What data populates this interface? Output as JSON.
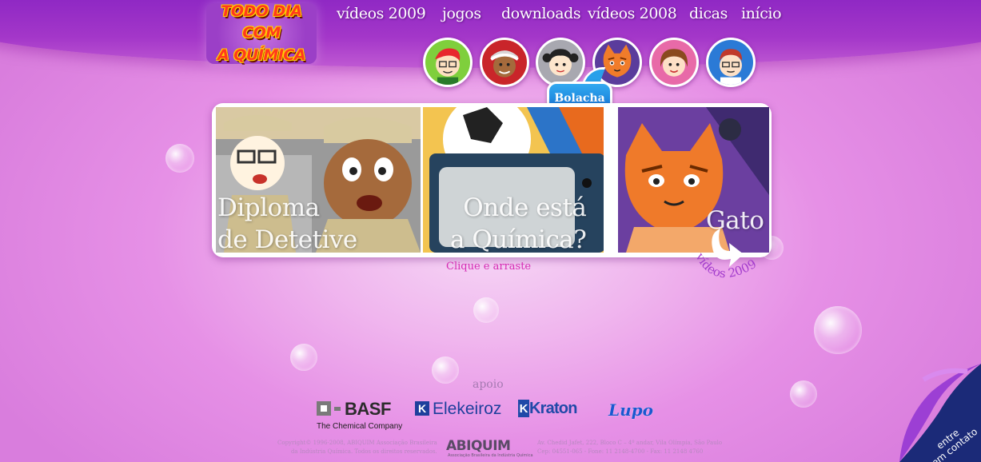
{
  "logo": {
    "line1": "TODO DIA COM",
    "line2": "A QUÍMICA"
  },
  "nav": [
    {
      "label": "vídeos 2009"
    },
    {
      "label": "jogos"
    },
    {
      "label": "downloads"
    },
    {
      "label": "vídeos 2008"
    },
    {
      "label": "dicas"
    },
    {
      "label": "início"
    }
  ],
  "characters": {
    "tooltip": "Bolacha"
  },
  "carousel": {
    "slides": [
      {
        "title": "Diploma\nde Detetive"
      },
      {
        "title": "Onde está\na Química?"
      },
      {
        "title": "Gato"
      }
    ],
    "hint": "Clique e arraste"
  },
  "stamp": {
    "word": "vídeos",
    "year": "2009"
  },
  "footer": {
    "apoio": "apoio",
    "sponsors": {
      "basf": "BASF",
      "basf_sub": "The Chemical Company",
      "elekeiroz": "Elekeiroz",
      "kraton": "Kraton",
      "lupo": "Lupo"
    },
    "copyright": "Copyright© 1996-2008, ABIQUIM Associação Brasileira\nda Indústria Química. Todos os direitos reservados.",
    "abiquim": "ABIQUIM",
    "abiquim_sub": "Associação Brasileira da Indústria Química",
    "address": "Av. Chedid Jafet, 222, Bloco C – 4º andar, Vila Olímpia, São Paulo\nCep: 04551-065 - Fone: 11 2148-4700 - Fax: 11 2148 4760"
  },
  "contact_corner": {
    "line1": "entre",
    "line2": "em contato"
  },
  "colors": {
    "band": "#8b26c4",
    "background": "#e690e6",
    "hint": "#d62db4",
    "tooltip": "#1e8fe3"
  }
}
